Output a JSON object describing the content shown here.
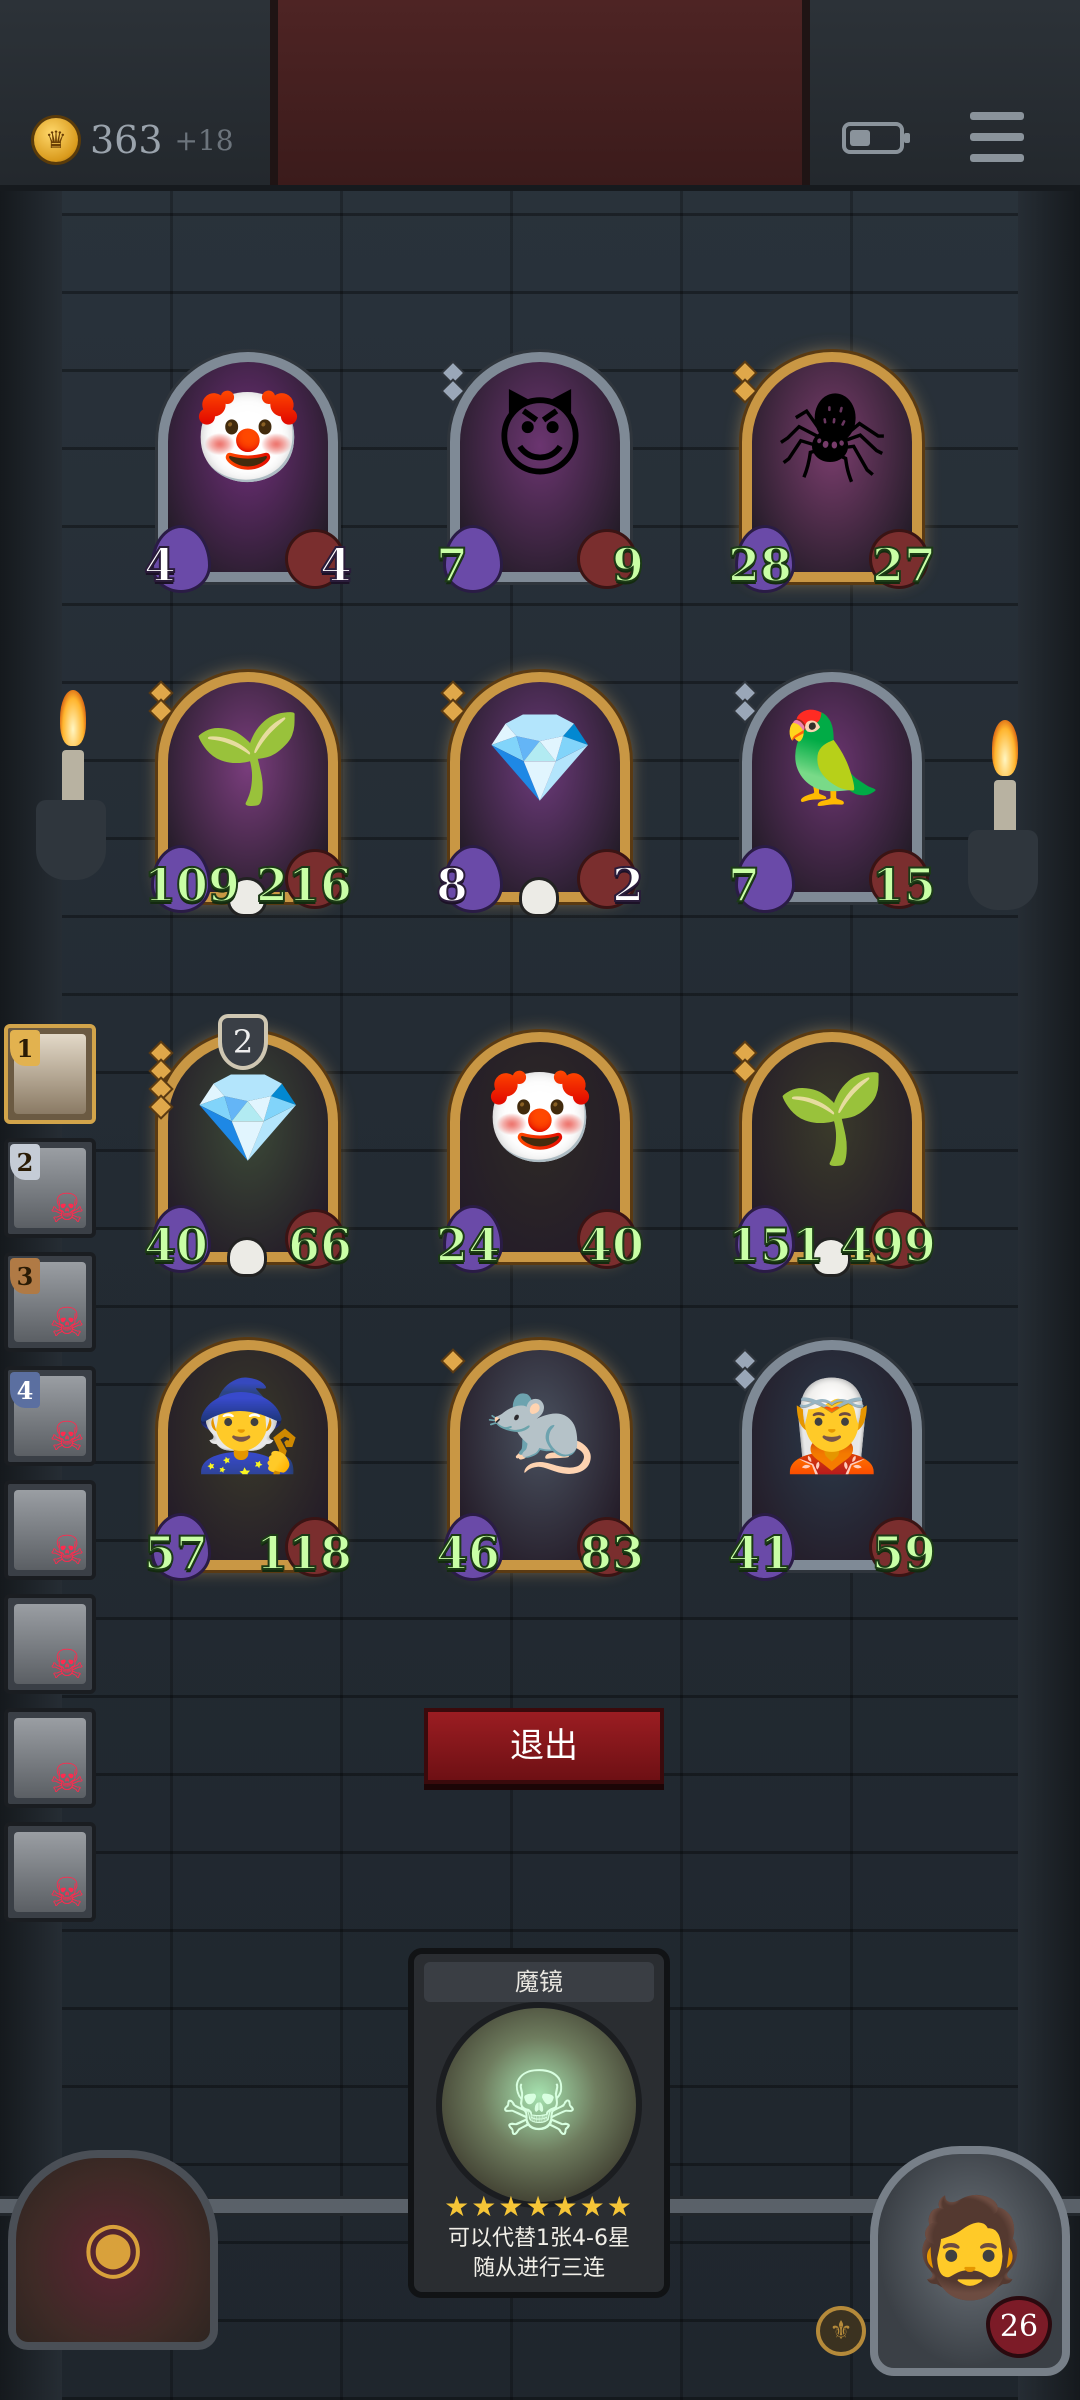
{
  "header": {
    "gold": "363",
    "gold_income": "+18",
    "battery_level": 0.4
  },
  "board": {
    "row1": [
      {
        "attack": "4",
        "health": "4",
        "portrait": "🤡",
        "frame": "silver",
        "theme": "#6e2f78",
        "gems": 0,
        "white": true
      },
      {
        "attack": "7",
        "health": "9",
        "portrait": "😈",
        "frame": "silver",
        "theme": "#6b3570",
        "gems": 2,
        "white": false
      },
      {
        "attack": "28",
        "health": "27",
        "portrait": "🕷",
        "frame": "gold",
        "theme": "#7a3d6d",
        "gems": 2,
        "white": false
      }
    ],
    "row2": [
      {
        "attack": "109",
        "health": "216",
        "portrait": "🌱",
        "frame": "gold",
        "theme": "#7a3d7d",
        "gems": 2,
        "white": false,
        "skull": true
      },
      {
        "attack": "8",
        "health": "2",
        "portrait": "💎",
        "frame": "gold",
        "theme": "#6c3a7a",
        "gems": 2,
        "white": true,
        "skull": true
      },
      {
        "attack": "7",
        "health": "15",
        "portrait": "🦜",
        "frame": "silver",
        "theme": "#6b3570",
        "gems": 2,
        "white": false
      }
    ],
    "row3": [
      {
        "attack": "40",
        "health": "66",
        "portrait": "💎",
        "frame": "gold",
        "theme": "#3c4a37",
        "gems": 4,
        "white": false,
        "skull": true
      },
      {
        "attack": "24",
        "health": "40",
        "portrait": "🤡",
        "frame": "gold",
        "theme": "#2e2a26",
        "gems": 0,
        "white": false
      },
      {
        "attack": "151",
        "health": "499",
        "portrait": "🌱",
        "frame": "gold",
        "theme": "#3a3a2a",
        "gems": 2,
        "white": false,
        "skull": true
      }
    ],
    "row4": [
      {
        "attack": "57",
        "health": "118",
        "portrait": "🧙",
        "frame": "gold",
        "theme": "#3a3a2a",
        "gems": 0,
        "white": false
      },
      {
        "attack": "46",
        "health": "83",
        "portrait": "🐀",
        "frame": "gold",
        "theme": "#4a5260",
        "gems": 1,
        "white": false
      },
      {
        "attack": "41",
        "health": "59",
        "portrait": "🧝",
        "frame": "silver",
        "theme": "#2b3a4a",
        "gems": 2,
        "white": false
      }
    ],
    "tier_badge": "2"
  },
  "opponents": [
    {
      "rank": "1",
      "rank_style": "gold",
      "active": true,
      "dead": false
    },
    {
      "rank": "2",
      "rank_style": "silver",
      "active": false,
      "dead": true
    },
    {
      "rank": "3",
      "rank_style": "bronze",
      "active": false,
      "dead": true
    },
    {
      "rank": "4",
      "rank_style": "blue",
      "active": false,
      "dead": true
    },
    {
      "rank": "",
      "rank_style": "",
      "active": false,
      "dead": true
    },
    {
      "rank": "",
      "rank_style": "",
      "active": false,
      "dead": true
    },
    {
      "rank": "",
      "rank_style": "",
      "active": false,
      "dead": true
    },
    {
      "rank": "",
      "rank_style": "",
      "active": false,
      "dead": true
    }
  ],
  "exit_button": "退出",
  "spell_card": {
    "title": "魔镜",
    "stars": "★★★★★★★",
    "desc_line1": "可以代替1张4-6星",
    "desc_line2": "随从进行三连"
  },
  "hero": {
    "health": "26"
  },
  "icons": {
    "coin": "crown-coin-icon",
    "menu": "hamburger-menu-icon",
    "battery": "battery-icon",
    "skull": "skull-icon",
    "dead": "skull-crossbones-icon"
  }
}
